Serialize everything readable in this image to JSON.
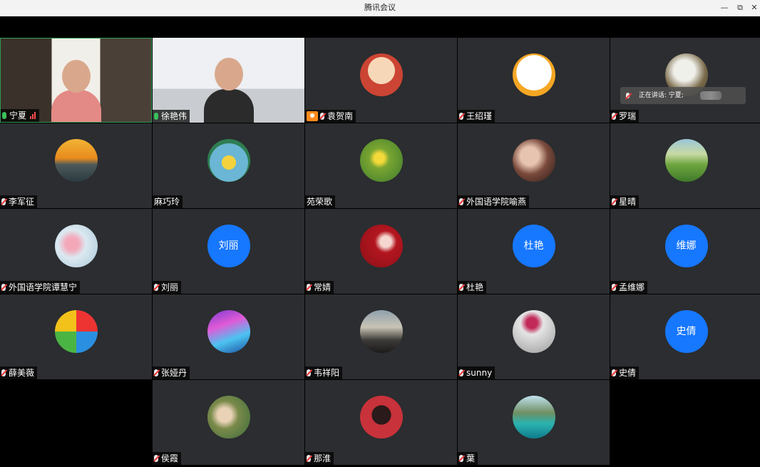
{
  "window": {
    "title": "腾讯会议",
    "buttons": {
      "minimize": "—",
      "maximize": "⧉",
      "close": "✕"
    }
  },
  "speaking_bar": {
    "label": "正在讲话: 宁夏;"
  },
  "participants": [
    {
      "name": "宁夏",
      "type": "video",
      "mic": "on",
      "signal": "weak"
    },
    {
      "name": "徐艳伟",
      "type": "video",
      "mic": "on"
    },
    {
      "name": "袁贺南",
      "type": "avatar-image",
      "mic": "muted",
      "host": true
    },
    {
      "name": "王绍瑾",
      "type": "avatar-image",
      "mic": "muted"
    },
    {
      "name": "罗瑞",
      "type": "avatar-image",
      "mic": "muted"
    },
    {
      "name": "李军征",
      "type": "avatar-image",
      "mic": "muted"
    },
    {
      "name": "麻巧玲",
      "type": "avatar-image",
      "mic": "none"
    },
    {
      "name": "苑荣歌",
      "type": "avatar-image",
      "mic": "none"
    },
    {
      "name": "外国语学院喻燕",
      "type": "avatar-image",
      "mic": "muted"
    },
    {
      "name": "星晴",
      "type": "avatar-image",
      "mic": "muted"
    },
    {
      "name": "外国语学院谭慧宁",
      "type": "avatar-image",
      "mic": "muted"
    },
    {
      "name": "刘丽",
      "type": "avatar-text",
      "avatar_text": "刘丽",
      "mic": "muted"
    },
    {
      "name": "常婧",
      "type": "avatar-image",
      "mic": "muted"
    },
    {
      "name": "杜艳",
      "type": "avatar-text",
      "avatar_text": "杜艳",
      "mic": "muted"
    },
    {
      "name": "孟维娜",
      "type": "avatar-text",
      "avatar_text": "维娜",
      "mic": "muted"
    },
    {
      "name": "薛美薇",
      "type": "avatar-image",
      "mic": "muted"
    },
    {
      "name": "张娅丹",
      "type": "avatar-image",
      "mic": "muted"
    },
    {
      "name": "韦祥阳",
      "type": "avatar-image",
      "mic": "muted"
    },
    {
      "name": "sunny",
      "type": "avatar-image",
      "mic": "muted"
    },
    {
      "name": "史倩",
      "type": "avatar-text",
      "avatar_text": "史倩",
      "mic": "muted"
    },
    {
      "name": "侯霞",
      "type": "avatar-image",
      "mic": "muted"
    },
    {
      "name": "那淮",
      "type": "avatar-image",
      "mic": "muted"
    },
    {
      "name": "葉",
      "type": "avatar-image",
      "mic": "muted"
    }
  ],
  "colors": {
    "tile_bg": "#2b2d30",
    "avatar_blue": "#1677ff",
    "active_border": "#2e9c54",
    "host_badge": "#ff8a1c"
  }
}
